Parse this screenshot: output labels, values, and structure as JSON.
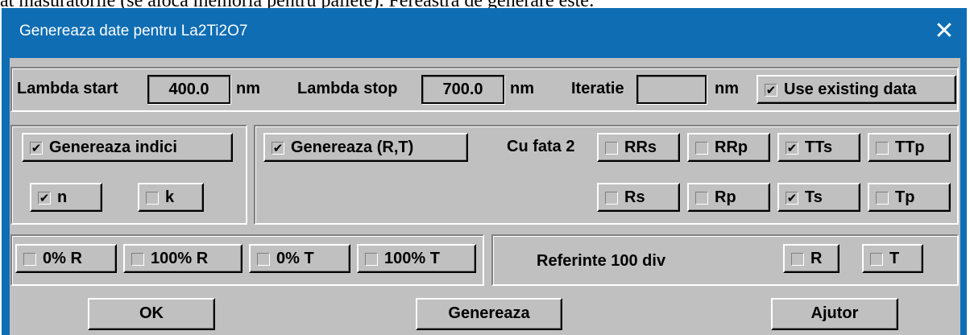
{
  "document": {
    "text_fragment": "at masuratorile (se aloca memoria pentru paliete). Fereastra de generare este:"
  },
  "window": {
    "title": "Genereaza date pentru La2Ti2O7",
    "close_glyph": "✕"
  },
  "range": {
    "lambda_start_label": "Lambda start",
    "lambda_start_value": "400.0",
    "lambda_start_unit": "nm",
    "lambda_stop_label": "Lambda stop",
    "lambda_stop_value": "700.0",
    "lambda_stop_unit": "nm",
    "iteratie_label": "Iteratie",
    "iteratie_value": "",
    "iteratie_unit": "nm",
    "use_existing": {
      "label": "Use existing data",
      "checked": true
    }
  },
  "indici": {
    "genereaza": {
      "label": "Genereaza indici",
      "checked": true
    },
    "n": {
      "label": "n",
      "checked": true
    },
    "k": {
      "label": "k",
      "checked": false
    }
  },
  "rt": {
    "genereaza": {
      "label": "Genereaza (R,T)",
      "checked": true
    },
    "cu_fata_label": "Cu fata 2",
    "RRs": {
      "label": "RRs",
      "checked": false
    },
    "RRp": {
      "label": "RRp",
      "checked": false
    },
    "TTs": {
      "label": "TTs",
      "checked": true
    },
    "TTp": {
      "label": "TTp",
      "checked": false
    },
    "Rs": {
      "label": "Rs",
      "checked": false
    },
    "Rp": {
      "label": "Rp",
      "checked": false
    },
    "Ts": {
      "label": "Ts",
      "checked": true
    },
    "Tp": {
      "label": "Tp",
      "checked": false
    }
  },
  "calib": {
    "r0": {
      "label": "0% R",
      "checked": false
    },
    "r100": {
      "label": "100% R",
      "checked": false
    },
    "t0": {
      "label": "0% T",
      "checked": false
    },
    "t100": {
      "label": "100% T",
      "checked": false
    }
  },
  "ref": {
    "label": "Referinte 100 div",
    "R": {
      "label": "R",
      "checked": false
    },
    "T": {
      "label": "T",
      "checked": false
    }
  },
  "buttons": {
    "ok": "OK",
    "genereaza": "Genereaza",
    "ajutor": "Ajutor"
  },
  "colors": {
    "titlebar": "#0e6db3",
    "face": "#c0c0c0",
    "title_text": "#ffffff"
  }
}
